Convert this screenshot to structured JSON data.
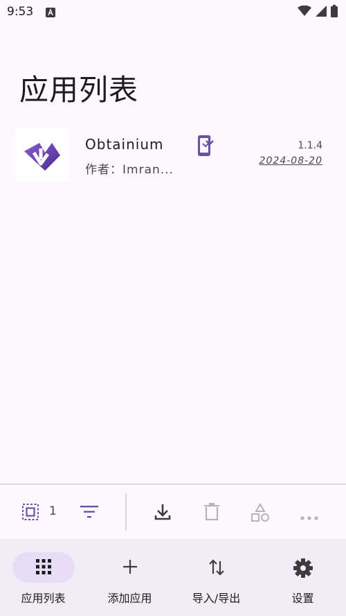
{
  "status_bar": {
    "time": "9:53",
    "icons": [
      "a-notification-icon",
      "wifi-icon",
      "cell-signal-icon",
      "battery-icon"
    ]
  },
  "page": {
    "title": "应用列表"
  },
  "apps": [
    {
      "name": "Obtainium",
      "author": "作者：Imran...",
      "version": "1.1.4",
      "date": "2024-08-20",
      "icon": "install-update-icon"
    }
  ],
  "toolbar": {
    "selected_count": "1",
    "icons": [
      "select-all-icon",
      "filter-icon",
      "download-icon",
      "delete-icon",
      "categories-icon",
      "more-icon"
    ]
  },
  "bottom_nav": {
    "items": [
      {
        "label": "应用列表",
        "icon": "apps-grid-icon",
        "active": true
      },
      {
        "label": "添加应用",
        "icon": "plus-icon",
        "active": false
      },
      {
        "label": "导入/导出",
        "icon": "import-export-icon",
        "active": false
      },
      {
        "label": "设置",
        "icon": "gear-icon",
        "active": false
      }
    ]
  },
  "colors": {
    "background": "#fdf8fd",
    "accent": "#6b4fa6",
    "nav_background": "#f2ecf4",
    "nav_active_pill": "#e8ddf6"
  }
}
